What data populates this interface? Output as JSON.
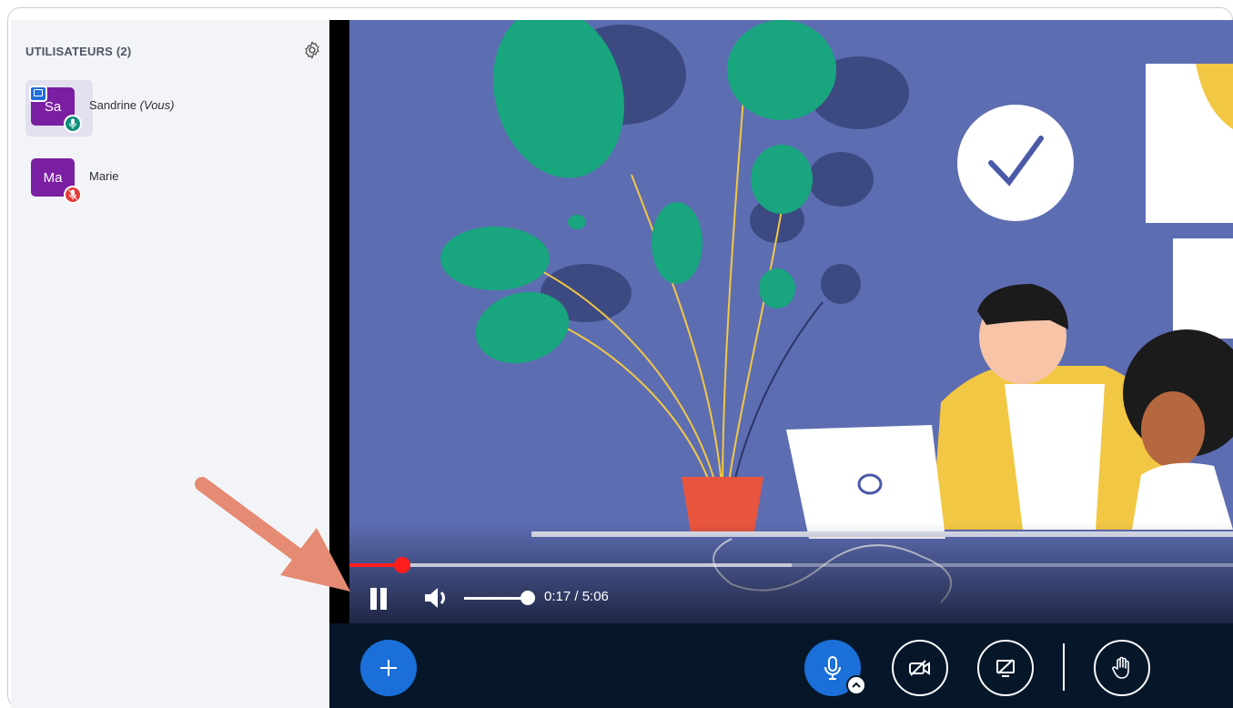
{
  "sidebar": {
    "title": "UTILISATEURS (2)",
    "users": [
      {
        "initials": "Sa",
        "name": "Sandrine",
        "suffix": "(Vous)",
        "presenter": true,
        "status": "mic-on",
        "avatar_color": "#7b1fa2"
      },
      {
        "initials": "Ma",
        "name": "Marie",
        "suffix": "",
        "presenter": false,
        "status": "mic-muted",
        "avatar_color": "#7b1fa2"
      }
    ]
  },
  "player": {
    "time": "0:17 / 5:06",
    "progress_fraction": 0.06,
    "buffered_fraction": 0.5,
    "volume_fraction": 1.0,
    "state": "playing"
  },
  "colors": {
    "accent": "#1b6fd8",
    "progress": "#ff1e1e",
    "action_bar": "#06172a",
    "sidebar_bg": "#f3f4f7",
    "annotation_arrow": "#e58a73"
  },
  "icons": {
    "settings": "gear-icon",
    "pause": "pause-icon",
    "volume": "volume-icon",
    "add": "plus-icon",
    "mic": "microphone-icon",
    "camera": "camera-off-icon",
    "share": "screen-share-off-icon",
    "hand": "raise-hand-icon"
  }
}
